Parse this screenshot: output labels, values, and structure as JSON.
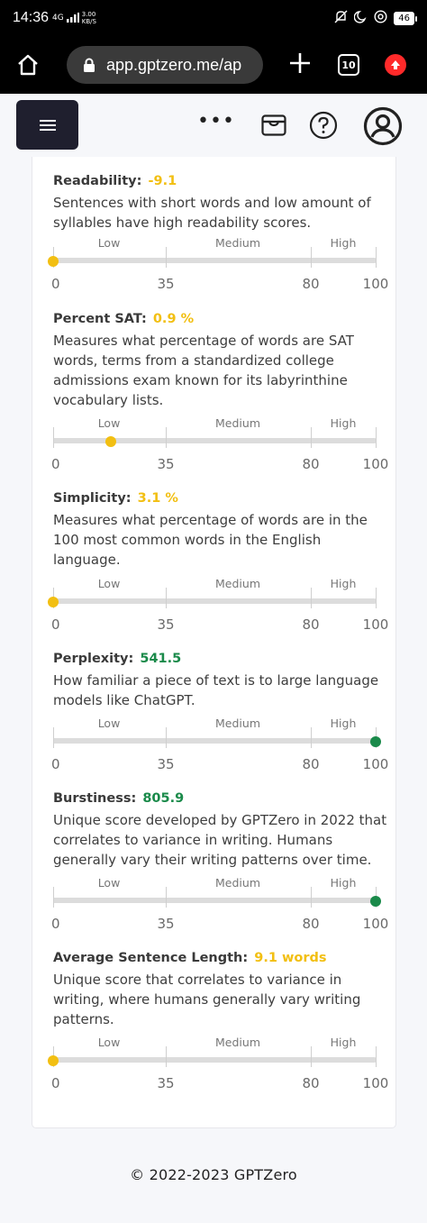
{
  "status_bar": {
    "time": "14:36",
    "network": "4G",
    "signal": "▎▏▐█",
    "speed_value": "3.00",
    "speed_unit": "KB/S",
    "battery": "46"
  },
  "browser": {
    "url": "app.gptzero.me/ap",
    "tab_count": "10"
  },
  "header": {
    "more_label": "•••"
  },
  "scale": {
    "bands": [
      "Low",
      "Medium",
      "High"
    ],
    "numbers": [
      "0",
      "35",
      "80",
      "100"
    ]
  },
  "colors": {
    "yellow": "#f2bf12",
    "green": "#1a8a4a",
    "menu_bg": "#1f1f2e"
  },
  "metrics": [
    {
      "title": "Readability:",
      "value": "-9.1",
      "color": "#f2bf12",
      "description": "Sentences with short words and low amount of syllables have high readability scores.",
      "level": 0
    },
    {
      "title": "Percent SAT:",
      "value": "0.9 %",
      "color": "#f2bf12",
      "description": "Measures what percentage of words are SAT words, terms from a standardized college admissions exam known for its labyrinthine vocabulary lists.",
      "level": 18
    },
    {
      "title": "Simplicity:",
      "value": "3.1 %",
      "color": "#f2bf12",
      "description": "Measures what percentage of words are in the 100 most common words in the English language.",
      "level": 0
    },
    {
      "title": "Perplexity:",
      "value": "541.5",
      "color": "#1a8a4a",
      "description": "How familiar a piece of text is to large language models like ChatGPT.",
      "level": 100
    },
    {
      "title": "Burstiness:",
      "value": "805.9",
      "color": "#1a8a4a",
      "description": "Unique score developed by GPTZero in 2022 that correlates to variance in writing. Humans generally vary their writing patterns over time.",
      "level": 100
    },
    {
      "title": "Average Sentence Length:",
      "value": "9.1 words",
      "color": "#f2bf12",
      "description": "Unique score that correlates to variance in writing, where humans generally vary writing patterns.",
      "level": 0
    }
  ],
  "footer": {
    "copyright": "© 2022-2023 GPTZero"
  }
}
